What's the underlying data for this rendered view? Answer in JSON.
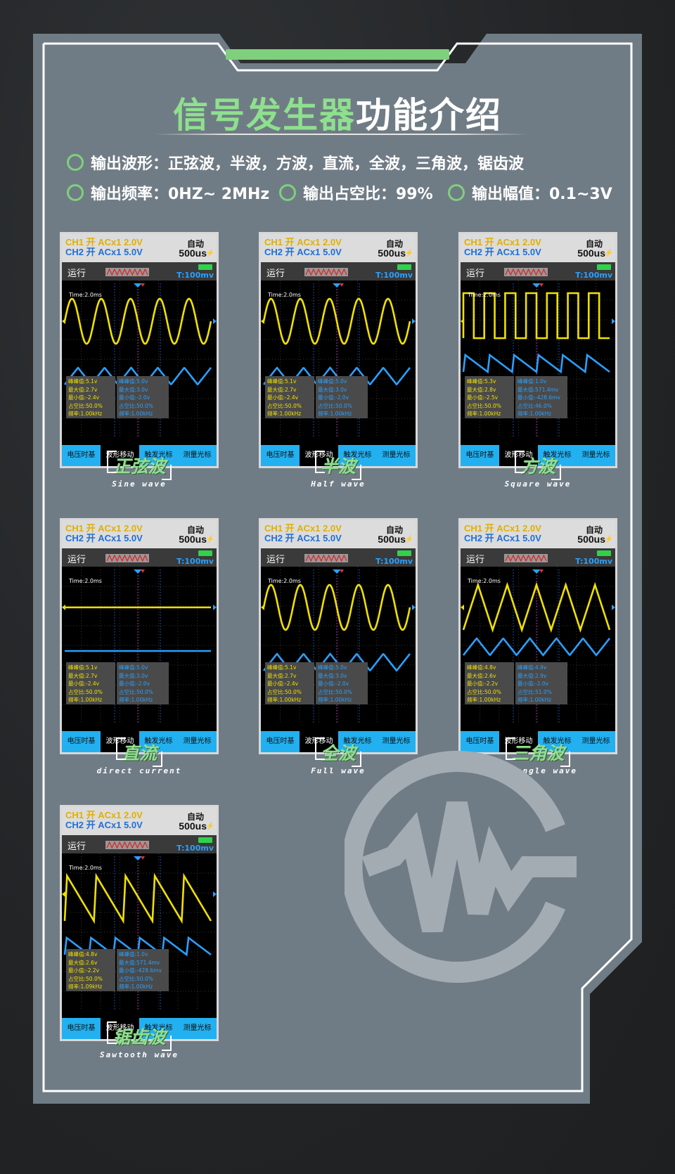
{
  "title": {
    "part1": "信号发生器",
    "part2": "功能介绍"
  },
  "features": {
    "waveforms": "输出波形：正弦波，半波，方波，直流，全波，三角波，锯齿波",
    "frequency": "输出频率：0HZ~ 2MHz",
    "duty": "输出占空比：99%",
    "amplitude": "输出幅值：0.1~3V"
  },
  "colors": {
    "accent_green": "#7fd07c",
    "ch1_yellow": "#f0e000",
    "ch2_blue": "#2aa0ff",
    "button_blue": "#22b0f0"
  },
  "common": {
    "ch1_row": "CH1  开  ACx1  2.0V",
    "ch2_row": "CH2  开  ACx1  5.0V",
    "auto": "自动",
    "timebase": "500us",
    "run": "运行",
    "tdiv": "T:100mv",
    "time": "Time:2.0ms",
    "buttons": [
      "电压时基",
      "波形移动",
      "触发光标",
      "测量光标"
    ]
  },
  "cards": [
    {
      "cn": "正弦波",
      "en": "Sine wave",
      "wave": "sine",
      "active_button": 1,
      "ch1": [
        "峰峰值:5.1v",
        "最大值:2.7v",
        "最小值:-2.4v",
        "占空比:50.0%",
        "频率:1.00kHz"
      ],
      "ch2": [
        "峰峰值:5.0v",
        "最大值:3.0v",
        "最小值:-2.0v",
        "占空比:50.0%",
        "频率:1.00kHz"
      ]
    },
    {
      "cn": "半波",
      "en": "Half wave",
      "wave": "sine",
      "active_button": 1,
      "ch1": [
        "峰峰值:5.1v",
        "最大值:2.7v",
        "最小值:-2.4v",
        "占空比:50.0%",
        "频率:1.00kHz"
      ],
      "ch2": [
        "峰峰值:5.0v",
        "最大值:3.0v",
        "最小值:-2.0v",
        "占空比:50.0%",
        "频率:1.00kHz"
      ]
    },
    {
      "cn": "方波",
      "en": "Square wave",
      "wave": "square",
      "active_button": 1,
      "ch1": [
        "峰峰值:5.3v",
        "最大值:2.8v",
        "最小值:-2.5v",
        "占空比:50.0%",
        "频率:1.00kHz"
      ],
      "ch2": [
        "峰峰值:1.0v",
        "最大值:571.4mv",
        "最小值:-428.6mv",
        "占空比:46.0%",
        "频率:1.00kHz"
      ]
    },
    {
      "cn": "直流",
      "en": "direct current",
      "wave": "dc",
      "active_button": 1,
      "ch1": [
        "峰峰值:5.1v",
        "最大值:2.7v",
        "最小值:-2.4v",
        "占空比:50.0%",
        "频率:1.00kHz"
      ],
      "ch2": [
        "峰峰值:5.0v",
        "最大值:3.0v",
        "最小值:-2.0v",
        "占空比:50.0%",
        "频率:1.00kHz"
      ]
    },
    {
      "cn": "全波",
      "en": "Full wave",
      "wave": "sine",
      "active_button": 1,
      "ch1": [
        "峰峰值:5.1v",
        "最大值:2.7v",
        "最小值:-2.4v",
        "占空比:50.0%",
        "频率:1.00kHz"
      ],
      "ch2": [
        "峰峰值:5.0v",
        "最大值:3.0v",
        "最小值:-2.0v",
        "占空比:50.0%",
        "频率:1.00kHz"
      ]
    },
    {
      "cn": "三角波",
      "en": "Triangle wave",
      "wave": "triangle",
      "active_button": 1,
      "ch1": [
        "峰峰值:4.8v",
        "最大值:2.6v",
        "最小值:-2.2v",
        "占空比:50.0%",
        "频率:1.00kHz"
      ],
      "ch2": [
        "峰峰值:4.9v",
        "最大值:2.9v",
        "最小值:-2.0v",
        "占空比:51.0%",
        "频率:1.00kHz"
      ]
    },
    {
      "cn": "锯齿波",
      "en": "Sawtooth wave",
      "wave": "sawtooth",
      "active_button": 1,
      "ch1": [
        "峰峰值:4.8v",
        "最大值:2.6v",
        "最小值:-2.2v",
        "占空比:50.0%",
        "频率:1.09kHz"
      ],
      "ch2": [
        "峰峰值:1.0v",
        "最大值:571.4mv",
        "最小值:-428.6mv",
        "占空比:50.0%",
        "频率:1.00kHz"
      ]
    }
  ]
}
